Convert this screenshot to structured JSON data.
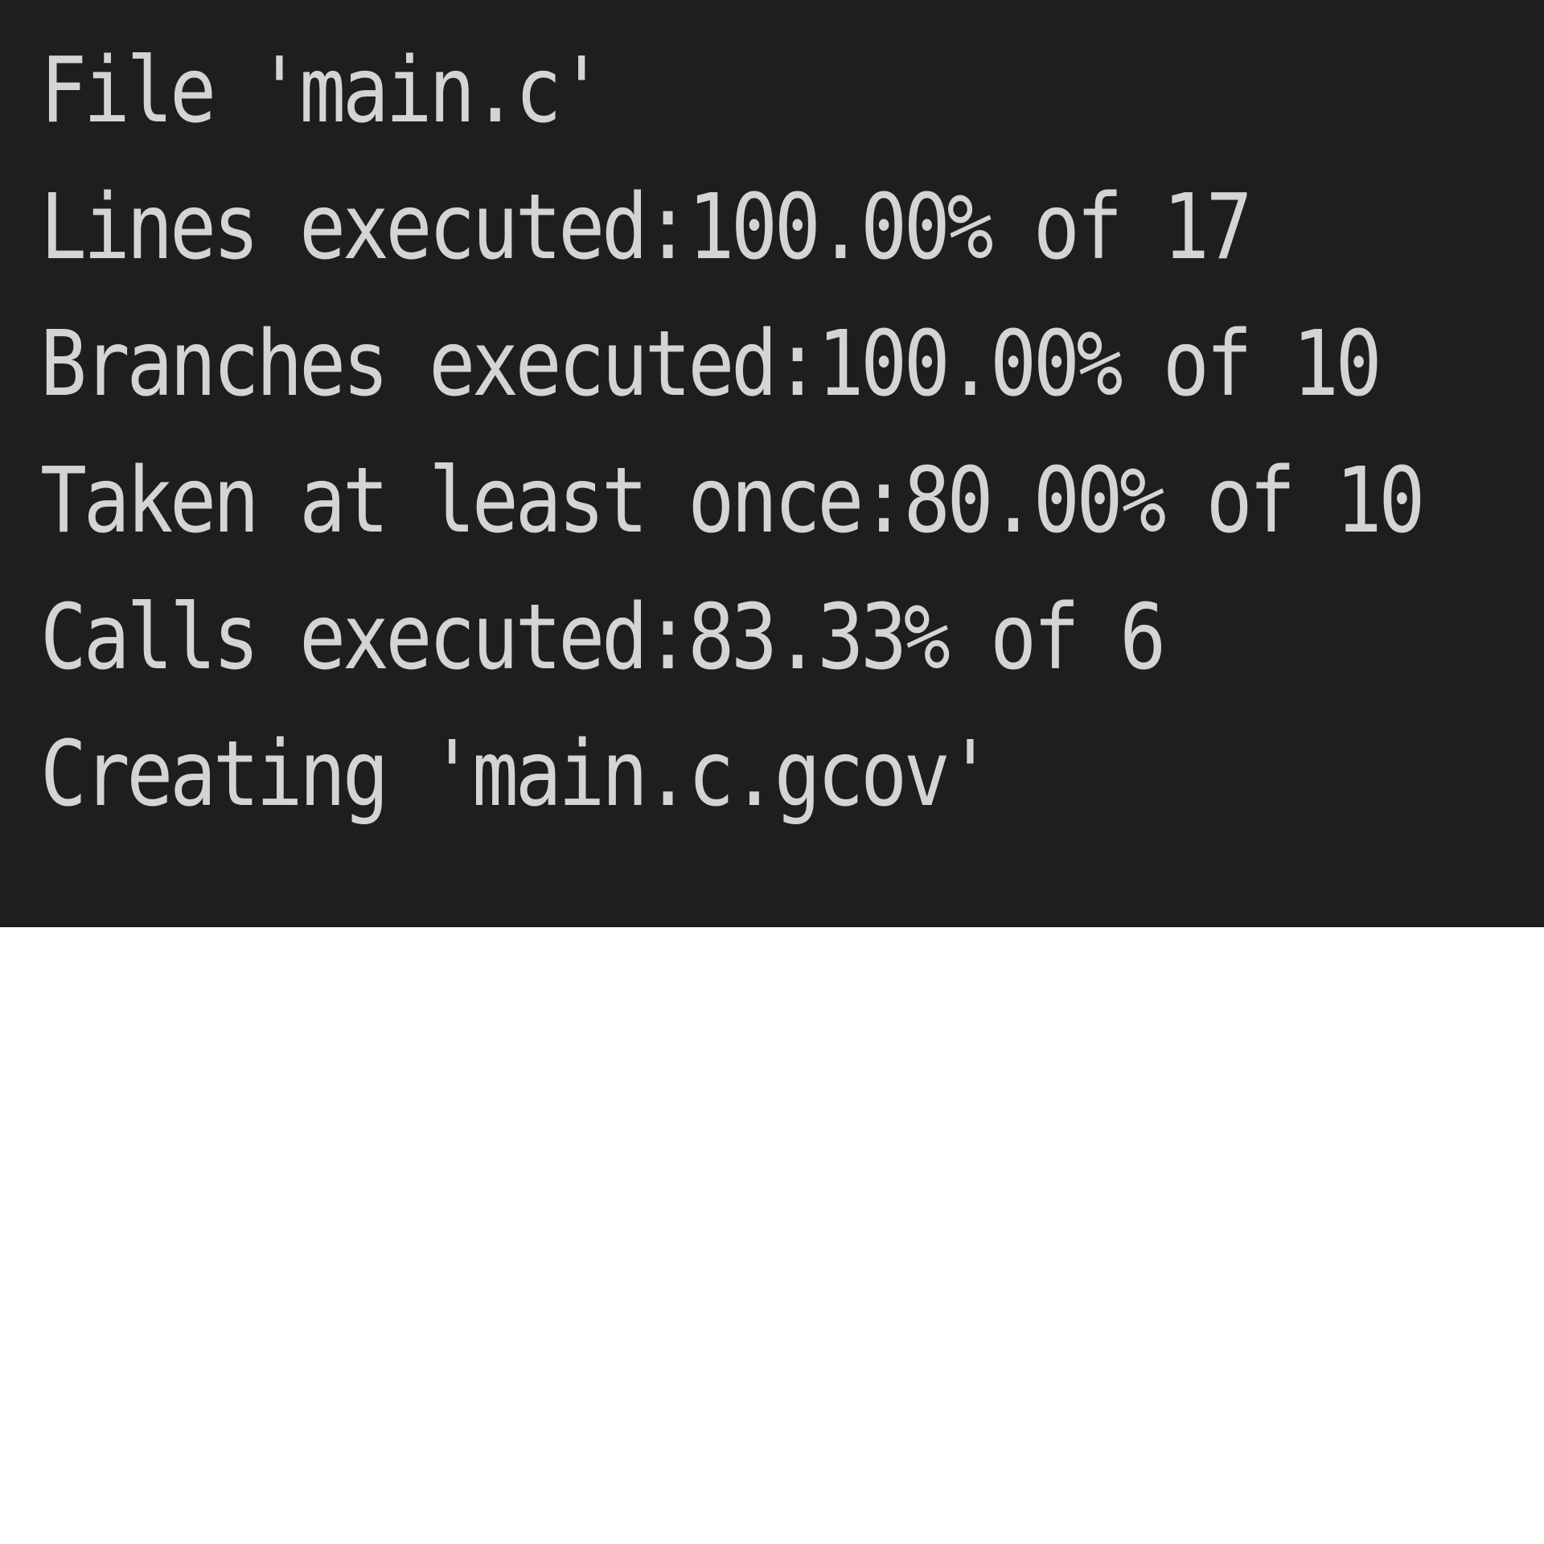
{
  "terminal": {
    "background": "#1e1e1e",
    "text_color": "#d4d4d4",
    "lines": [
      "File 'main.c'",
      "Lines executed:100.00% of 17",
      "Branches executed:100.00% of 10",
      "Taken at least once:80.00% of 10",
      "Calls executed:83.33% of 6",
      "Creating 'main.c.gcov'"
    ]
  }
}
